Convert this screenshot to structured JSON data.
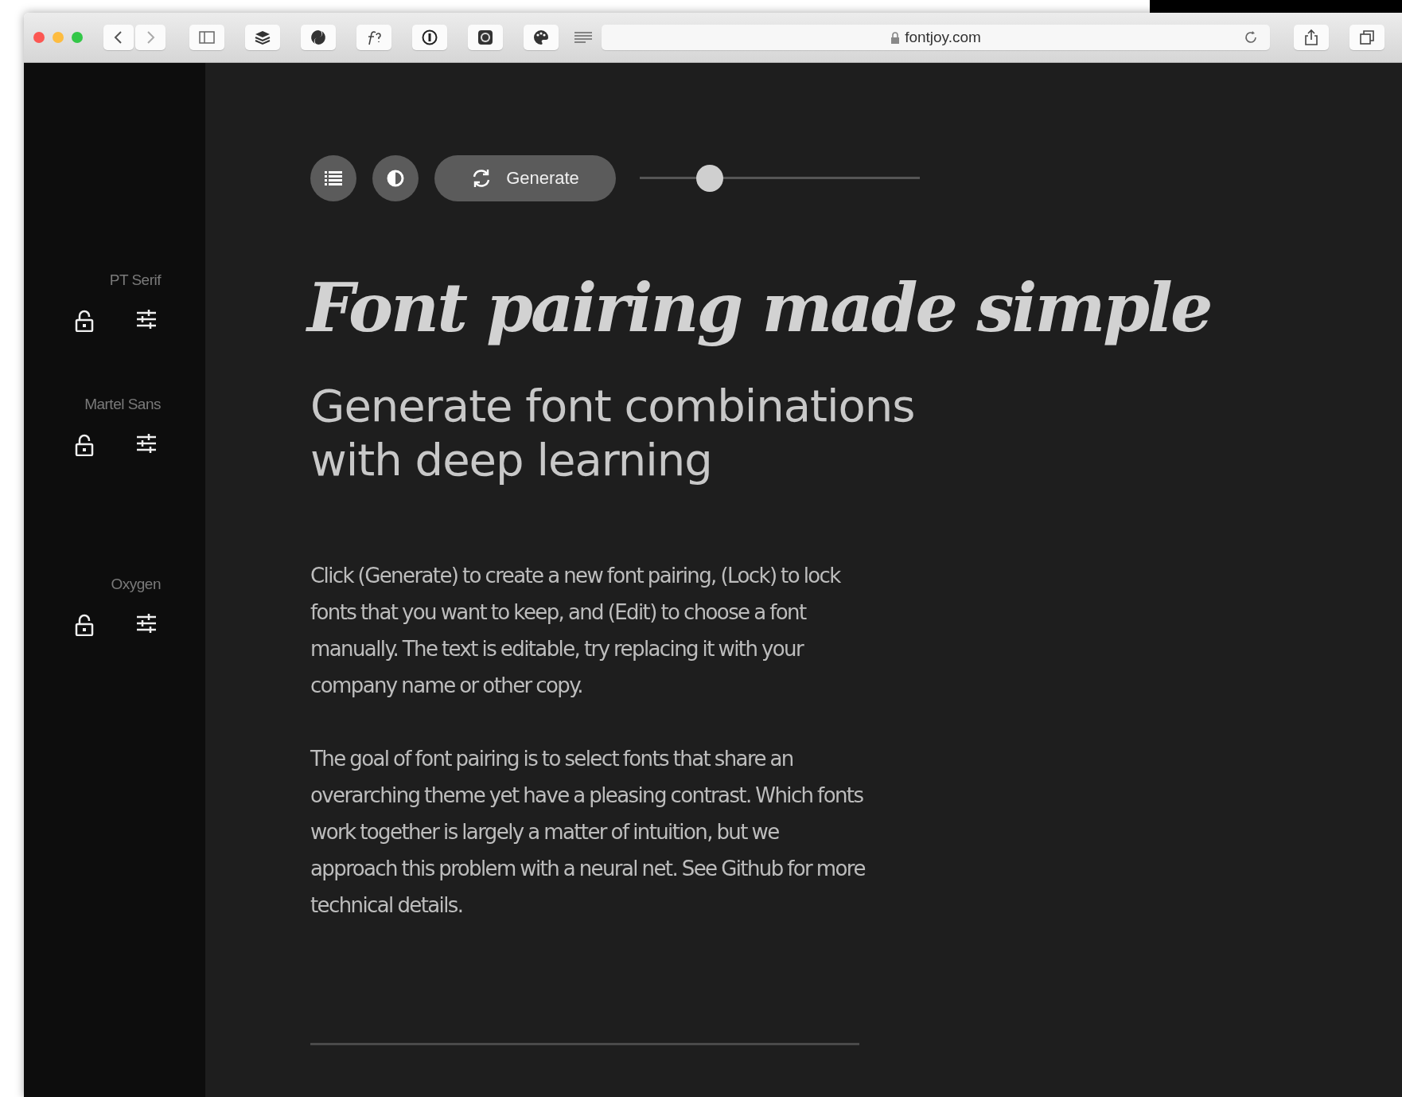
{
  "browser": {
    "url": "fontjoy.com"
  },
  "toolbar": {
    "generate_label": "Generate",
    "slider": {
      "level": 0.25
    }
  },
  "fonts": [
    {
      "name": "PT Serif",
      "locked": false
    },
    {
      "name": "Martel Sans",
      "locked": false
    },
    {
      "name": "Oxygen",
      "locked": false
    }
  ],
  "headline": "Font pairing made simple",
  "subheadline": "Generate font combinations with deep learning",
  "paragraphs": [
    "Click (Generate) to create a new font pairing, (Lock) to lock fonts that you want to keep, and (Edit) to choose a font manually. The text is editable, try replacing it with your company name or other copy.",
    "The goal of font pairing is to select fonts that share an overarching theme yet have a pleasing contrast. Which fonts work together is largely a matter of intuition, but we approach this problem with a neural net. See Github for more technical details."
  ]
}
